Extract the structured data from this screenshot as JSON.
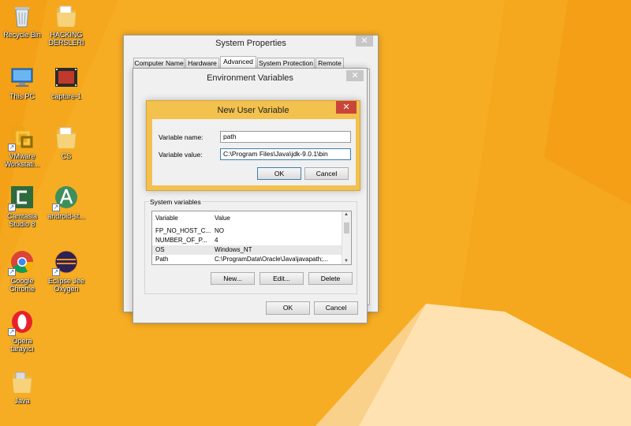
{
  "desktop": {
    "icons": [
      {
        "label": "Recycle Bin",
        "icon": "recycle-bin-icon"
      },
      {
        "label": "HACKING DERSLERI",
        "icon": "folder-icon"
      },
      {
        "label": "This PC",
        "icon": "computer-icon"
      },
      {
        "label": "capture-1",
        "icon": "video-file-icon"
      },
      {
        "label": "VMware Workstati...",
        "icon": "vmware-icon"
      },
      {
        "label": "CS",
        "icon": "folder-icon"
      },
      {
        "label": "Camtasia Studio 8",
        "icon": "camtasia-icon"
      },
      {
        "label": "android-st...",
        "icon": "android-studio-icon"
      },
      {
        "label": "Google Chrome",
        "icon": "chrome-icon"
      },
      {
        "label": "Eclipse Jee Oxygen",
        "icon": "eclipse-icon"
      },
      {
        "label": "Opera tarayıcı",
        "icon": "opera-icon"
      },
      {
        "label": "Java",
        "icon": "folder-icon"
      }
    ],
    "background_color": "#f5a81d"
  },
  "system_properties": {
    "title": "System Properties",
    "tabs": [
      "Computer Name",
      "Hardware",
      "Advanced",
      "System Protection",
      "Remote"
    ],
    "active_tab": "Advanced"
  },
  "env_vars": {
    "title": "Environment Variables",
    "system_variables_label": "System variables",
    "columns": [
      "Variable",
      "Value"
    ],
    "rows": [
      {
        "variable": "FP_NO_HOST_C...",
        "value": "NO"
      },
      {
        "variable": "NUMBER_OF_P...",
        "value": "4"
      },
      {
        "variable": "OS",
        "value": "Windows_NT"
      },
      {
        "variable": "Path",
        "value": "C:\\ProgramData\\Oracle\\Java\\javapath;..."
      }
    ],
    "buttons": {
      "new": "New...",
      "edit": "Edit...",
      "delete": "Delete"
    },
    "ok": "OK",
    "cancel": "Cancel"
  },
  "new_user_variable": {
    "title": "New User Variable",
    "name_label": "Variable name:",
    "name_value": "path",
    "value_label": "Variable value:",
    "value_value": "C:\\Program Files\\Java\\jdk-9.0.1\\bin",
    "ok": "OK",
    "cancel": "Cancel",
    "accent_color": "#f2c14e"
  }
}
